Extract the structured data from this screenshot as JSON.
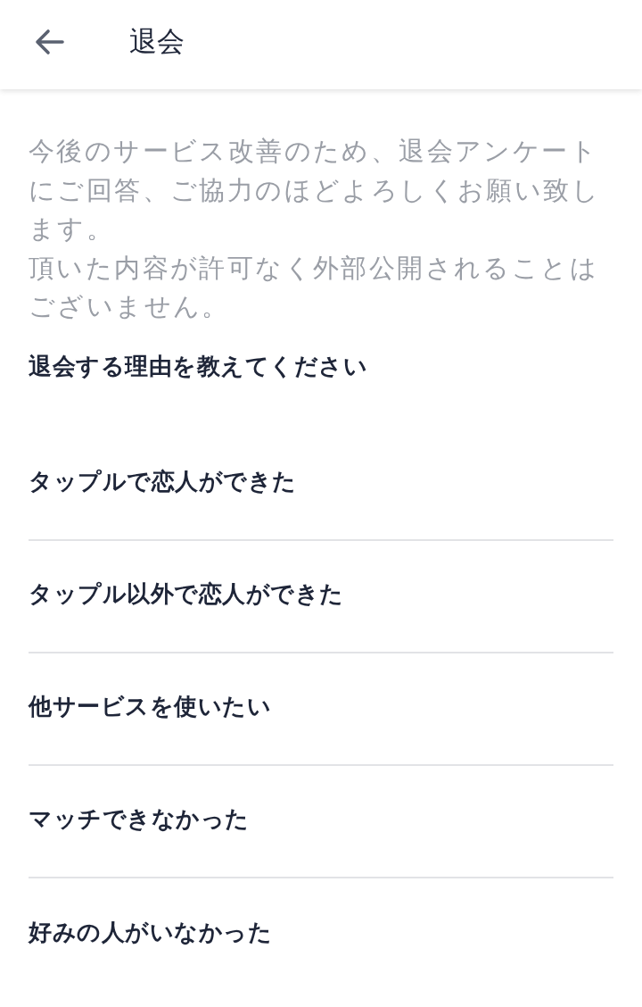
{
  "header": {
    "title": "退会"
  },
  "intro": [
    "今後のサービス改善のため、退会アンケートにご回答、ご協力のほどよろしくお願い致します。",
    "頂いた内容が許可なく外部公開されることはございません。"
  ],
  "question": "退会する理由を教えてください",
  "options": [
    {
      "label": "タップルで恋人ができた"
    },
    {
      "label": "タップル以外で恋人ができた"
    },
    {
      "label": "他サービスを使いたい"
    },
    {
      "label": "マッチできなかった"
    },
    {
      "label": "好みの人がいなかった"
    }
  ]
}
